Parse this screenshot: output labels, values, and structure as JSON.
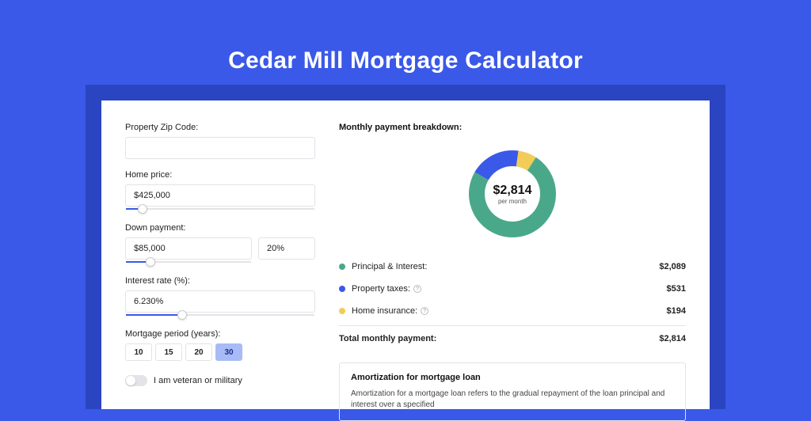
{
  "title": "Cedar Mill Mortgage Calculator",
  "form": {
    "zip_label": "Property Zip Code:",
    "zip_value": "",
    "home_price_label": "Home price:",
    "home_price_value": "$425,000",
    "home_price_slider_pct": 9,
    "down_payment_label": "Down payment:",
    "down_payment_value": "$85,000",
    "down_payment_pct_value": "20%",
    "down_payment_slider_pct": 20,
    "rate_label": "Interest rate (%):",
    "rate_value": "6.230%",
    "rate_slider_pct": 30,
    "period_label": "Mortgage period (years):",
    "periods": [
      "10",
      "15",
      "20",
      "30"
    ],
    "period_active_index": 3,
    "veteran_label": "I am veteran or military",
    "veteran_on": false
  },
  "breakdown": {
    "title": "Monthly payment breakdown:",
    "center_amount": "$2,814",
    "center_sub": "per month",
    "items": [
      {
        "label": "Principal & Interest:",
        "amount": "$2,089",
        "color": "#4aa88a",
        "has_help": false
      },
      {
        "label": "Property taxes:",
        "amount": "$531",
        "color": "#3a59e8",
        "has_help": true
      },
      {
        "label": "Home insurance:",
        "amount": "$194",
        "color": "#f2cc56",
        "has_help": true
      }
    ],
    "total_label": "Total monthly payment:",
    "total_amount": "$2,814"
  },
  "chart_data": {
    "type": "pie",
    "title": "Monthly payment breakdown",
    "series": [
      {
        "name": "Principal & Interest",
        "value": 2089,
        "color": "#4aa88a"
      },
      {
        "name": "Property taxes",
        "value": 531,
        "color": "#3a59e8"
      },
      {
        "name": "Home insurance",
        "value": 194,
        "color": "#f2cc56"
      }
    ],
    "total": 2814,
    "center_label": "$2,814",
    "center_sublabel": "per month"
  },
  "amortization": {
    "title": "Amortization for mortgage loan",
    "text": "Amortization for a mortgage loan refers to the gradual repayment of the loan principal and interest over a specified"
  }
}
